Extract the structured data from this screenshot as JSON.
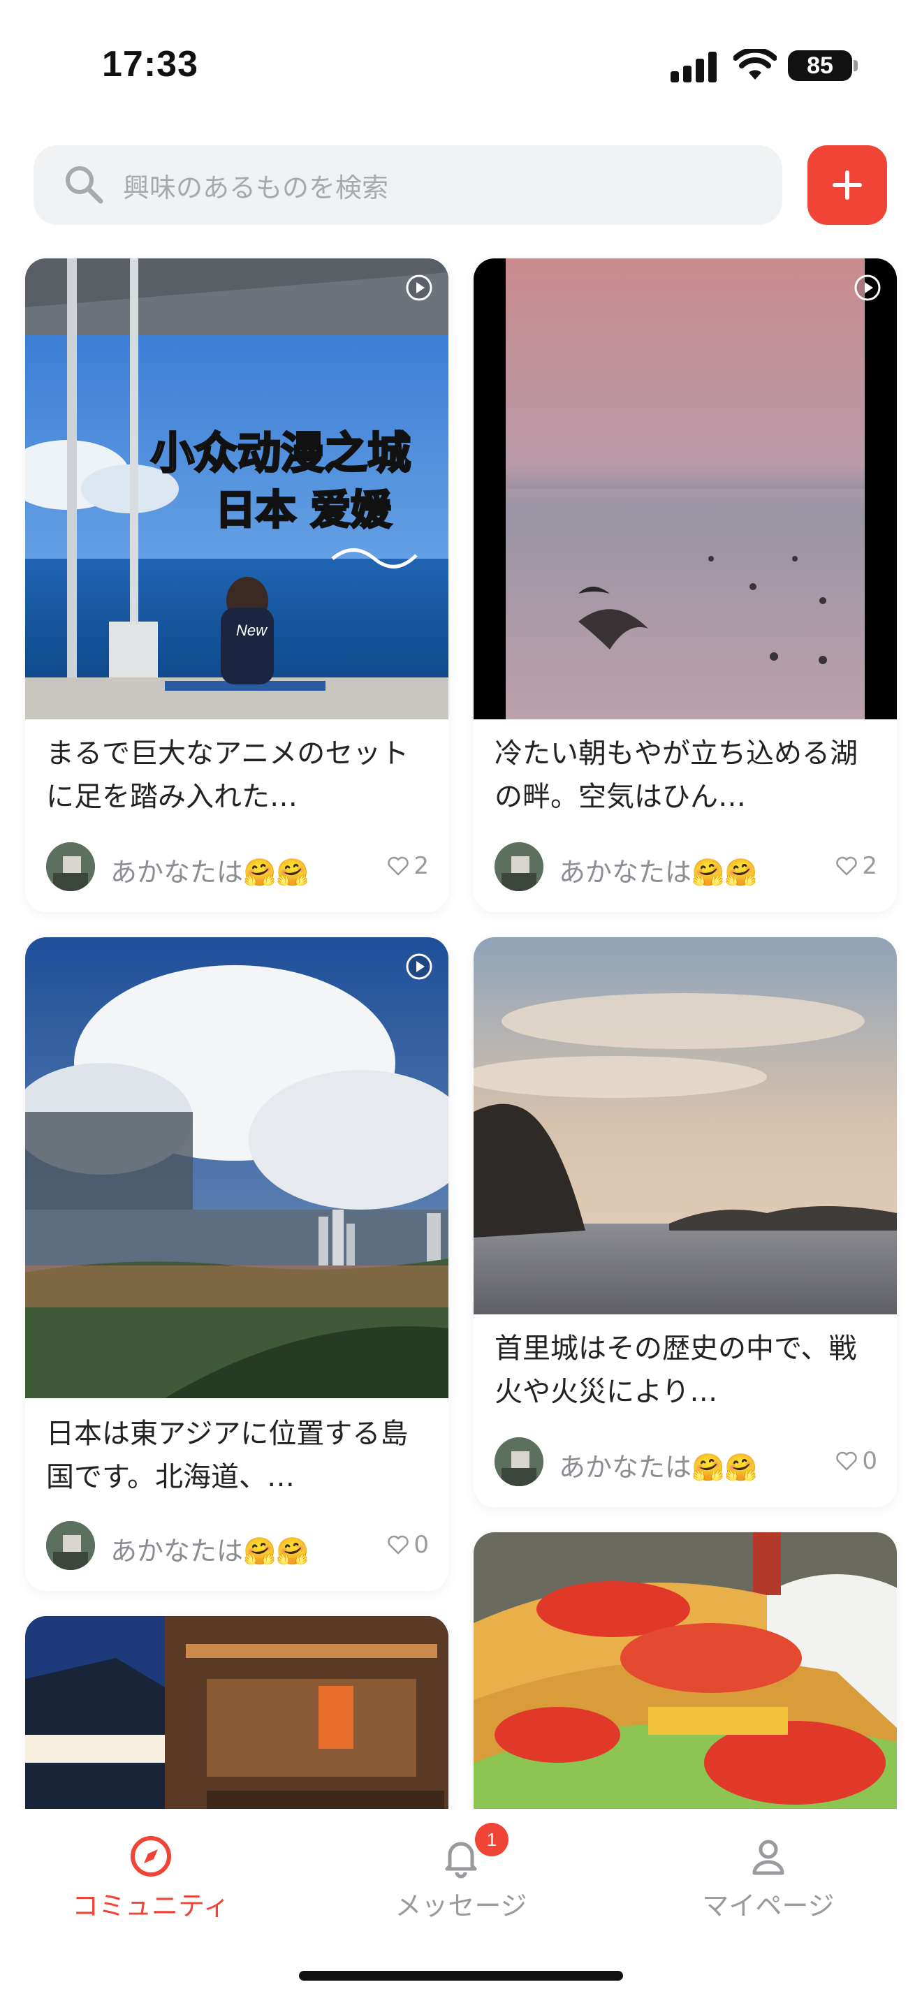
{
  "status_bar": {
    "time": "17:33",
    "battery": "85"
  },
  "search": {
    "placeholder": "興味のあるものを検索"
  },
  "posts": [
    {
      "title": "まるで巨大なアニメのセットに足を踏み入れた…",
      "author": "あかなたは🤗🤗",
      "likes": "2",
      "video": true,
      "overlay_line1": "小众动漫之城",
      "overlay_line2": "日本 爱媛"
    },
    {
      "title": "冷たい朝もやが立ち込める湖の畔。空気はひん…",
      "author": "あかなたは🤗🤗",
      "likes": "2",
      "video": true
    },
    {
      "title": "日本は東アジアに位置する島国です。北海道、…",
      "author": "あかなたは🤗🤗",
      "likes": "0",
      "video": true
    },
    {
      "title": "首里城はその歴史の中で、戦火や火災により…",
      "author": "あかなたは🤗🤗",
      "likes": "0",
      "video": false
    },
    {
      "title": "",
      "author": "",
      "likes": "",
      "video": false
    },
    {
      "title": "",
      "author": "",
      "likes": "",
      "video": false
    }
  ],
  "tabs": [
    {
      "label": "コミュニティ",
      "icon": "compass-icon",
      "active": true
    },
    {
      "label": "メッセージ",
      "icon": "bell-icon",
      "badge": "1"
    },
    {
      "label": "マイページ",
      "icon": "person-icon"
    }
  ],
  "colors": {
    "accent": "#f04437",
    "inactive": "#9a9a9e",
    "background": "#ffffff"
  }
}
